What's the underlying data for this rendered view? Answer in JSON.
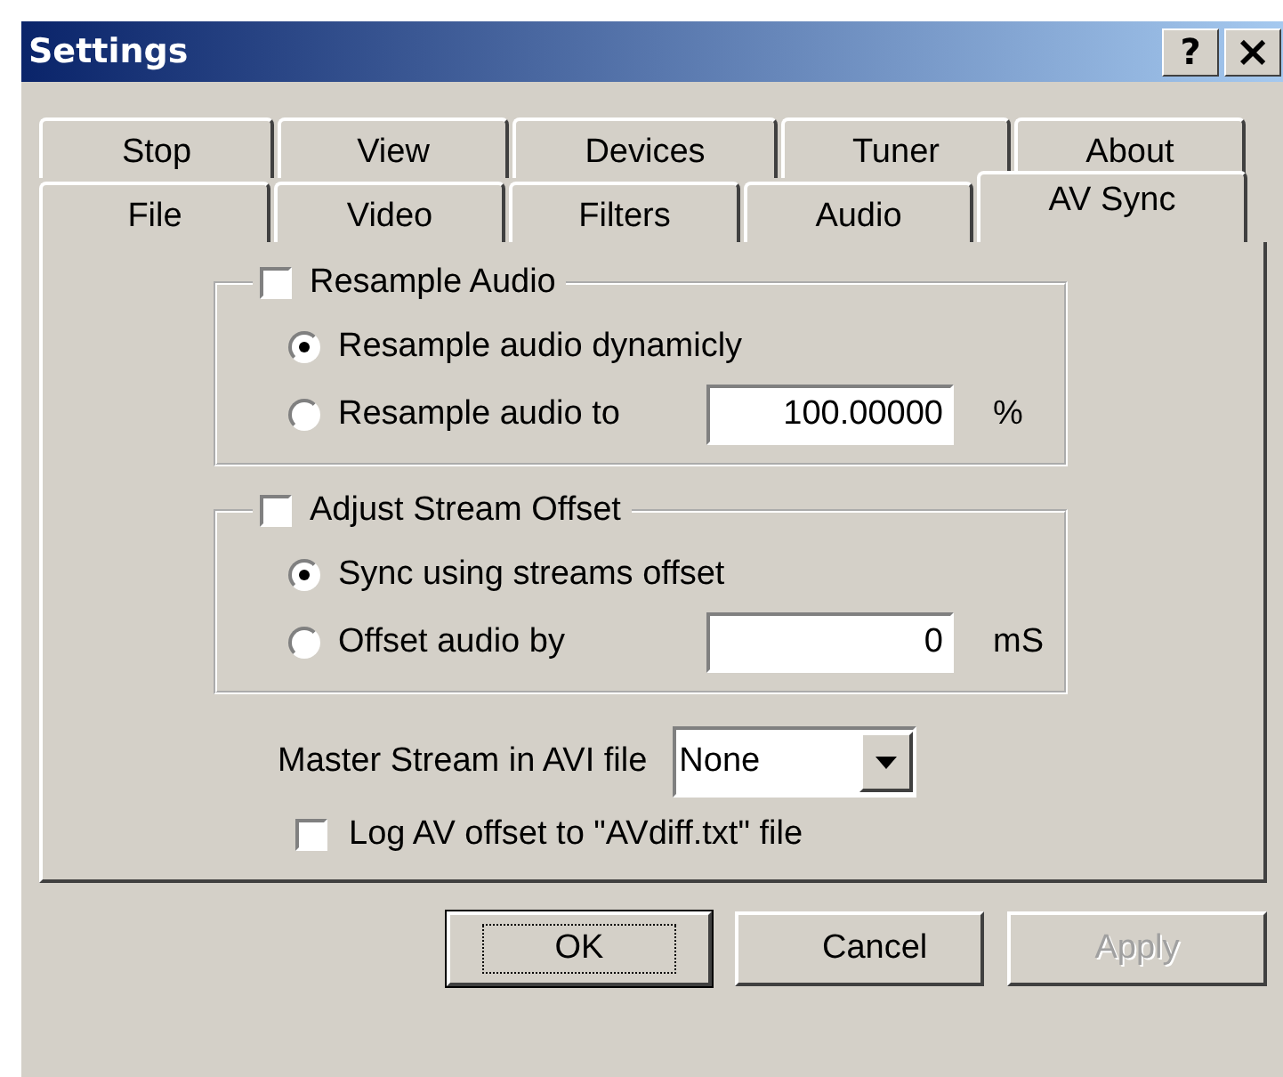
{
  "window": {
    "title": "Settings",
    "title_buttons": [
      {
        "kind": "help",
        "label": "?"
      },
      {
        "kind": "close",
        "label": "×"
      }
    ]
  },
  "tab_rows": [
    [
      {
        "label": "Stop",
        "selected": false
      },
      {
        "label": "View",
        "selected": false
      },
      {
        "label": "Devices",
        "selected": false
      },
      {
        "label": "Tuner",
        "selected": false
      },
      {
        "label": "About",
        "selected": false
      }
    ],
    [
      {
        "label": "File",
        "selected": false
      },
      {
        "label": "Video",
        "selected": false
      },
      {
        "label": "Filters",
        "selected": false
      },
      {
        "label": "Audio",
        "selected": false
      },
      {
        "label": "AV Sync",
        "selected": true
      }
    ]
  ],
  "groups": [
    {
      "label": "Resample Audio",
      "checked": false,
      "options": [
        {
          "label": "Resample audio dynamicly",
          "selected": true
        },
        {
          "label": "Resample audio to",
          "selected": false,
          "value": "100.00000",
          "unit": "%"
        }
      ]
    },
    {
      "label": "Adjust Stream Offset",
      "checked": false,
      "options": [
        {
          "label": "Sync using streams offset",
          "selected": true
        },
        {
          "label": "Offset audio by",
          "selected": false,
          "value": "0",
          "unit": "mS"
        }
      ]
    }
  ],
  "master_stream": {
    "label": "Master Stream in AVI file",
    "value": "None"
  },
  "log_checkbox": {
    "label": "Log AV offset to \"AVdiff.txt\" file",
    "checked": false
  },
  "buttons": [
    {
      "label": "OK",
      "default": true,
      "disabled": false
    },
    {
      "label": "Cancel",
      "default": false,
      "disabled": false
    },
    {
      "label": "Apply",
      "default": false,
      "disabled": true
    }
  ]
}
